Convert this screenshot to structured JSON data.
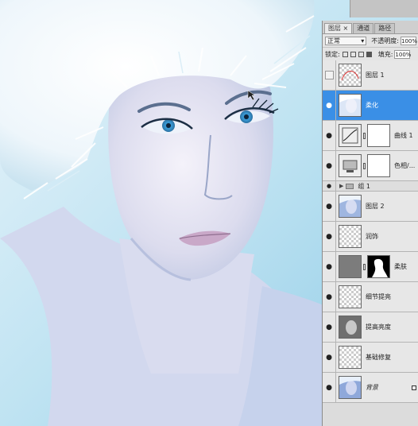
{
  "panel": {
    "tabs": [
      {
        "label": "图层 ×",
        "active": true
      },
      {
        "label": "通道",
        "active": false
      },
      {
        "label": "路径",
        "active": false
      }
    ],
    "blend_mode": "正常",
    "opacity_label": "不透明度:",
    "opacity_value": "100%",
    "lock_label": "锁定:",
    "fill_label": "填充:",
    "fill_value": "100%"
  },
  "layers": [
    {
      "name": "图层 1",
      "visible": false,
      "thumb": "red-outline",
      "selected": false
    },
    {
      "name": "柔化",
      "visible": true,
      "thumb": "face",
      "selected": true
    },
    {
      "name": "曲线 1",
      "visible": true,
      "thumb": "curves-adjustment",
      "mask": "white",
      "selected": false
    },
    {
      "name": "色相/...",
      "visible": true,
      "thumb": "hue-adjustment",
      "mask": "white",
      "selected": false
    },
    {
      "name": "组 1",
      "visible": true,
      "type": "group",
      "selected": false
    },
    {
      "name": "图层 2",
      "visible": true,
      "thumb": "face",
      "selected": false
    },
    {
      "name": "润饰",
      "visible": true,
      "thumb": "transparent",
      "selected": false
    },
    {
      "name": "柔肤",
      "visible": true,
      "thumb": "grey",
      "mask": "black-silhouette",
      "selected": false
    },
    {
      "name": "细节提亮",
      "visible": true,
      "thumb": "transparent",
      "selected": false
    },
    {
      "name": "提高亮度",
      "visible": true,
      "thumb": "grey-face",
      "selected": false
    },
    {
      "name": "基础修复",
      "visible": true,
      "thumb": "transparent",
      "selected": false
    },
    {
      "name": "背景",
      "visible": true,
      "thumb": "face",
      "locked": true,
      "selected": false
    }
  ],
  "colors": {
    "selection": "#3a8fe6",
    "panel": "#dcdcdc",
    "sky": "#bfe3f2"
  }
}
